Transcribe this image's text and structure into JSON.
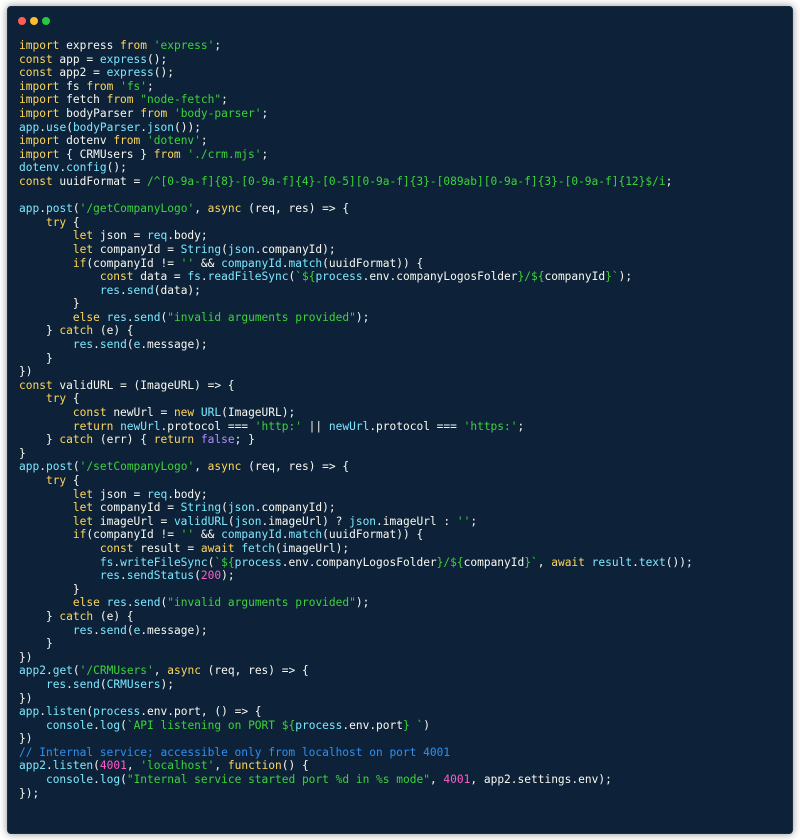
{
  "window": {
    "controls": [
      "close",
      "minimize",
      "maximize"
    ],
    "colors": {
      "background": "#0d2238",
      "keyword": "#ffd65a",
      "identifier": "#7ce8ff",
      "string": "#3bd33b",
      "number": "#ff5cc7",
      "comment": "#2f8ff0",
      "text": "#f8f8f2"
    }
  },
  "code_lines": [
    [
      [
        "kw",
        "import"
      ],
      [
        "plain",
        " express "
      ],
      [
        "kw",
        "from"
      ],
      [
        "plain",
        " "
      ],
      [
        "str",
        "'express'"
      ],
      [
        "plain",
        ";"
      ]
    ],
    [
      [
        "kw",
        "const"
      ],
      [
        "plain",
        " app = "
      ],
      [
        "fn",
        "express"
      ],
      [
        "plain",
        "();"
      ]
    ],
    [
      [
        "kw",
        "const"
      ],
      [
        "plain",
        " app2 = "
      ],
      [
        "fn",
        "express"
      ],
      [
        "plain",
        "();"
      ]
    ],
    [
      [
        "kw",
        "import"
      ],
      [
        "plain",
        " fs "
      ],
      [
        "kw",
        "from"
      ],
      [
        "plain",
        " "
      ],
      [
        "str",
        "'fs'"
      ],
      [
        "plain",
        ";"
      ]
    ],
    [
      [
        "kw",
        "import"
      ],
      [
        "plain",
        " fetch "
      ],
      [
        "kw",
        "from"
      ],
      [
        "plain",
        " "
      ],
      [
        "str",
        "\"node-fetch\""
      ],
      [
        "plain",
        ";"
      ]
    ],
    [
      [
        "kw",
        "import"
      ],
      [
        "plain",
        " bodyParser "
      ],
      [
        "kw",
        "from"
      ],
      [
        "plain",
        " "
      ],
      [
        "str",
        "'body-parser'"
      ],
      [
        "plain",
        ";"
      ]
    ],
    [
      [
        "fn",
        "app"
      ],
      [
        "plain",
        "."
      ],
      [
        "fn",
        "use"
      ],
      [
        "plain",
        "("
      ],
      [
        "fn",
        "bodyParser"
      ],
      [
        "plain",
        "."
      ],
      [
        "fn",
        "json"
      ],
      [
        "plain",
        "());"
      ]
    ],
    [
      [
        "kw",
        "import"
      ],
      [
        "plain",
        " dotenv "
      ],
      [
        "kw",
        "from"
      ],
      [
        "plain",
        " "
      ],
      [
        "str",
        "'dotenv'"
      ],
      [
        "plain",
        ";"
      ]
    ],
    [
      [
        "kw",
        "import"
      ],
      [
        "plain",
        " { CRMUsers } "
      ],
      [
        "kw",
        "from"
      ],
      [
        "plain",
        " "
      ],
      [
        "str",
        "'./crm.mjs'"
      ],
      [
        "plain",
        ";"
      ]
    ],
    [
      [
        "fn",
        "dotenv"
      ],
      [
        "plain",
        "."
      ],
      [
        "fn",
        "config"
      ],
      [
        "plain",
        "();"
      ]
    ],
    [
      [
        "kw",
        "const"
      ],
      [
        "plain",
        " uuidFormat = "
      ],
      [
        "str",
        "/^[0-9a-f]{8}-[0-9a-f]{4}-[0-5][0-9a-f]{3}-[089ab][0-9a-f]{3}-[0-9a-f]{12}$/i"
      ],
      [
        "plain",
        ";"
      ]
    ],
    [],
    [
      [
        "fn",
        "app"
      ],
      [
        "plain",
        "."
      ],
      [
        "fn",
        "post"
      ],
      [
        "plain",
        "("
      ],
      [
        "str",
        "'/getCompanyLogo'"
      ],
      [
        "plain",
        ", "
      ],
      [
        "kw",
        "async"
      ],
      [
        "plain",
        " (req, res) => {"
      ]
    ],
    [
      [
        "plain",
        "    "
      ],
      [
        "kw",
        "try"
      ],
      [
        "plain",
        " {"
      ]
    ],
    [
      [
        "plain",
        "        "
      ],
      [
        "kw",
        "let"
      ],
      [
        "plain",
        " json = "
      ],
      [
        "fn",
        "req"
      ],
      [
        "plain",
        ".body;"
      ]
    ],
    [
      [
        "plain",
        "        "
      ],
      [
        "kw",
        "let"
      ],
      [
        "plain",
        " companyId = "
      ],
      [
        "fn",
        "String"
      ],
      [
        "plain",
        "("
      ],
      [
        "fn",
        "json"
      ],
      [
        "plain",
        ".companyId);"
      ]
    ],
    [
      [
        "plain",
        "        "
      ],
      [
        "kw",
        "if"
      ],
      [
        "plain",
        "(companyId != "
      ],
      [
        "str",
        "''"
      ],
      [
        "plain",
        " && "
      ],
      [
        "fn",
        "companyId"
      ],
      [
        "plain",
        "."
      ],
      [
        "fn",
        "match"
      ],
      [
        "plain",
        "(uuidFormat)) {"
      ]
    ],
    [
      [
        "plain",
        "            "
      ],
      [
        "kw",
        "const"
      ],
      [
        "plain",
        " data = "
      ],
      [
        "fn",
        "fs"
      ],
      [
        "plain",
        "."
      ],
      [
        "fn",
        "readFileSync"
      ],
      [
        "plain",
        "("
      ],
      [
        "str",
        "`${"
      ],
      [
        "fn",
        "process"
      ],
      [
        "plain",
        ".env.companyLogosFolder"
      ],
      [
        "str",
        "}/${"
      ],
      [
        "plain",
        "companyId"
      ],
      [
        "str",
        "}`"
      ],
      [
        "plain",
        ");"
      ]
    ],
    [
      [
        "plain",
        "            "
      ],
      [
        "fn",
        "res"
      ],
      [
        "plain",
        "."
      ],
      [
        "fn",
        "send"
      ],
      [
        "plain",
        "(data);"
      ]
    ],
    [
      [
        "plain",
        "        }"
      ]
    ],
    [
      [
        "plain",
        "        "
      ],
      [
        "kw",
        "else"
      ],
      [
        "plain",
        " "
      ],
      [
        "fn",
        "res"
      ],
      [
        "plain",
        "."
      ],
      [
        "fn",
        "send"
      ],
      [
        "plain",
        "("
      ],
      [
        "str",
        "\"invalid arguments provided\""
      ],
      [
        "plain",
        ");"
      ]
    ],
    [
      [
        "plain",
        "    } "
      ],
      [
        "kw",
        "catch"
      ],
      [
        "plain",
        " (e) {"
      ]
    ],
    [
      [
        "plain",
        "        "
      ],
      [
        "fn",
        "res"
      ],
      [
        "plain",
        "."
      ],
      [
        "fn",
        "send"
      ],
      [
        "plain",
        "("
      ],
      [
        "fn",
        "e"
      ],
      [
        "plain",
        ".message);"
      ]
    ],
    [
      [
        "plain",
        "    }"
      ]
    ],
    [
      [
        "plain",
        "})"
      ]
    ],
    [
      [
        "kw",
        "const"
      ],
      [
        "plain",
        " validURL = (ImageURL) => {"
      ]
    ],
    [
      [
        "plain",
        "    "
      ],
      [
        "kw",
        "try"
      ],
      [
        "plain",
        " {"
      ]
    ],
    [
      [
        "plain",
        "        "
      ],
      [
        "kw",
        "const"
      ],
      [
        "plain",
        " newUrl = "
      ],
      [
        "kw",
        "new"
      ],
      [
        "plain",
        " "
      ],
      [
        "fn",
        "URL"
      ],
      [
        "plain",
        "(ImageURL);"
      ]
    ],
    [
      [
        "plain",
        "        "
      ],
      [
        "kw",
        "return"
      ],
      [
        "plain",
        " "
      ],
      [
        "fn",
        "newUrl"
      ],
      [
        "plain",
        ".protocol === "
      ],
      [
        "str",
        "'http:'"
      ],
      [
        "plain",
        " || "
      ],
      [
        "fn",
        "newUrl"
      ],
      [
        "plain",
        ".protocol === "
      ],
      [
        "str",
        "'https:'"
      ],
      [
        "plain",
        ";"
      ]
    ],
    [
      [
        "plain",
        "    } "
      ],
      [
        "kw",
        "catch"
      ],
      [
        "plain",
        " (err) { "
      ],
      [
        "kw",
        "return"
      ],
      [
        "plain",
        " "
      ],
      [
        "bool",
        "false"
      ],
      [
        "plain",
        "; }"
      ]
    ],
    [
      [
        "plain",
        "}"
      ]
    ],
    [
      [
        "fn",
        "app"
      ],
      [
        "plain",
        "."
      ],
      [
        "fn",
        "post"
      ],
      [
        "plain",
        "("
      ],
      [
        "str",
        "'/setCompanyLogo'"
      ],
      [
        "plain",
        ", "
      ],
      [
        "kw",
        "async"
      ],
      [
        "plain",
        " (req, res) => {"
      ]
    ],
    [
      [
        "plain",
        "    "
      ],
      [
        "kw",
        "try"
      ],
      [
        "plain",
        " {"
      ]
    ],
    [
      [
        "plain",
        "        "
      ],
      [
        "kw",
        "let"
      ],
      [
        "plain",
        " json = "
      ],
      [
        "fn",
        "req"
      ],
      [
        "plain",
        ".body;"
      ]
    ],
    [
      [
        "plain",
        "        "
      ],
      [
        "kw",
        "let"
      ],
      [
        "plain",
        " companyId = "
      ],
      [
        "fn",
        "String"
      ],
      [
        "plain",
        "("
      ],
      [
        "fn",
        "json"
      ],
      [
        "plain",
        ".companyId);"
      ]
    ],
    [
      [
        "plain",
        "        "
      ],
      [
        "kw",
        "let"
      ],
      [
        "plain",
        " imageUrl = "
      ],
      [
        "fn",
        "validURL"
      ],
      [
        "plain",
        "("
      ],
      [
        "fn",
        "json"
      ],
      [
        "plain",
        ".imageUrl) ? "
      ],
      [
        "fn",
        "json"
      ],
      [
        "plain",
        ".imageUrl : "
      ],
      [
        "str",
        "''"
      ],
      [
        "plain",
        ";"
      ]
    ],
    [
      [
        "plain",
        "        "
      ],
      [
        "kw",
        "if"
      ],
      [
        "plain",
        "(companyId != "
      ],
      [
        "str",
        "''"
      ],
      [
        "plain",
        " && "
      ],
      [
        "fn",
        "companyId"
      ],
      [
        "plain",
        "."
      ],
      [
        "fn",
        "match"
      ],
      [
        "plain",
        "(uuidFormat)) {"
      ]
    ],
    [
      [
        "plain",
        "            "
      ],
      [
        "kw",
        "const"
      ],
      [
        "plain",
        " result = "
      ],
      [
        "kw",
        "await"
      ],
      [
        "plain",
        " "
      ],
      [
        "fn",
        "fetch"
      ],
      [
        "plain",
        "(imageUrl);"
      ]
    ],
    [
      [
        "plain",
        "            "
      ],
      [
        "fn",
        "fs"
      ],
      [
        "plain",
        "."
      ],
      [
        "fn",
        "writeFileSync"
      ],
      [
        "plain",
        "("
      ],
      [
        "str",
        "`${"
      ],
      [
        "fn",
        "process"
      ],
      [
        "plain",
        ".env.companyLogosFolder"
      ],
      [
        "str",
        "}/${"
      ],
      [
        "plain",
        "companyId"
      ],
      [
        "str",
        "}`"
      ],
      [
        "plain",
        ", "
      ],
      [
        "kw",
        "await"
      ],
      [
        "plain",
        " "
      ],
      [
        "fn",
        "result"
      ],
      [
        "plain",
        "."
      ],
      [
        "fn",
        "text"
      ],
      [
        "plain",
        "());"
      ]
    ],
    [
      [
        "plain",
        "            "
      ],
      [
        "fn",
        "res"
      ],
      [
        "plain",
        "."
      ],
      [
        "fn",
        "sendStatus"
      ],
      [
        "plain",
        "("
      ],
      [
        "num",
        "200"
      ],
      [
        "plain",
        ");"
      ]
    ],
    [
      [
        "plain",
        "        }"
      ]
    ],
    [
      [
        "plain",
        "        "
      ],
      [
        "kw",
        "else"
      ],
      [
        "plain",
        " "
      ],
      [
        "fn",
        "res"
      ],
      [
        "plain",
        "."
      ],
      [
        "fn",
        "send"
      ],
      [
        "plain",
        "("
      ],
      [
        "str",
        "\"invalid arguments provided\""
      ],
      [
        "plain",
        ");"
      ]
    ],
    [
      [
        "plain",
        "    } "
      ],
      [
        "kw",
        "catch"
      ],
      [
        "plain",
        " (e) {"
      ]
    ],
    [
      [
        "plain",
        "        "
      ],
      [
        "fn",
        "res"
      ],
      [
        "plain",
        "."
      ],
      [
        "fn",
        "send"
      ],
      [
        "plain",
        "("
      ],
      [
        "fn",
        "e"
      ],
      [
        "plain",
        ".message);"
      ]
    ],
    [
      [
        "plain",
        "    }"
      ]
    ],
    [
      [
        "plain",
        "})"
      ]
    ],
    [
      [
        "fn",
        "app2"
      ],
      [
        "plain",
        "."
      ],
      [
        "fn",
        "get"
      ],
      [
        "plain",
        "("
      ],
      [
        "str",
        "'/CRMUsers'"
      ],
      [
        "plain",
        ", "
      ],
      [
        "kw",
        "async"
      ],
      [
        "plain",
        " (req, res) => {"
      ]
    ],
    [
      [
        "plain",
        "    "
      ],
      [
        "fn",
        "res"
      ],
      [
        "plain",
        "."
      ],
      [
        "fn",
        "send"
      ],
      [
        "plain",
        "("
      ],
      [
        "fn",
        "CRMUsers"
      ],
      [
        "plain",
        ");"
      ]
    ],
    [
      [
        "plain",
        "})"
      ]
    ],
    [
      [
        "fn",
        "app"
      ],
      [
        "plain",
        "."
      ],
      [
        "fn",
        "listen"
      ],
      [
        "plain",
        "("
      ],
      [
        "fn",
        "process"
      ],
      [
        "plain",
        ".env.port, () => {"
      ]
    ],
    [
      [
        "plain",
        "    "
      ],
      [
        "fn",
        "console"
      ],
      [
        "plain",
        "."
      ],
      [
        "fn",
        "log"
      ],
      [
        "plain",
        "("
      ],
      [
        "str",
        "`API listening on PORT ${"
      ],
      [
        "fn",
        "process"
      ],
      [
        "plain",
        ".env.port"
      ],
      [
        "str",
        "} `"
      ],
      [
        "plain",
        ")"
      ]
    ],
    [
      [
        "plain",
        "})"
      ]
    ],
    [
      [
        "cm",
        "// Internal service; accessible only from localhost on port 4001"
      ]
    ],
    [
      [
        "fn",
        "app2"
      ],
      [
        "plain",
        "."
      ],
      [
        "fn",
        "listen"
      ],
      [
        "plain",
        "("
      ],
      [
        "num",
        "4001"
      ],
      [
        "plain",
        ", "
      ],
      [
        "str",
        "'localhost'"
      ],
      [
        "plain",
        ", "
      ],
      [
        "kw",
        "function"
      ],
      [
        "plain",
        "() {"
      ]
    ],
    [
      [
        "plain",
        "    "
      ],
      [
        "fn",
        "console"
      ],
      [
        "plain",
        "."
      ],
      [
        "fn",
        "log"
      ],
      [
        "plain",
        "("
      ],
      [
        "str",
        "\"Internal service started port %d in %s mode\""
      ],
      [
        "plain",
        ", "
      ],
      [
        "num",
        "4001"
      ],
      [
        "plain",
        ", app2.settings.env);"
      ]
    ],
    [
      [
        "plain",
        "});"
      ]
    ]
  ]
}
